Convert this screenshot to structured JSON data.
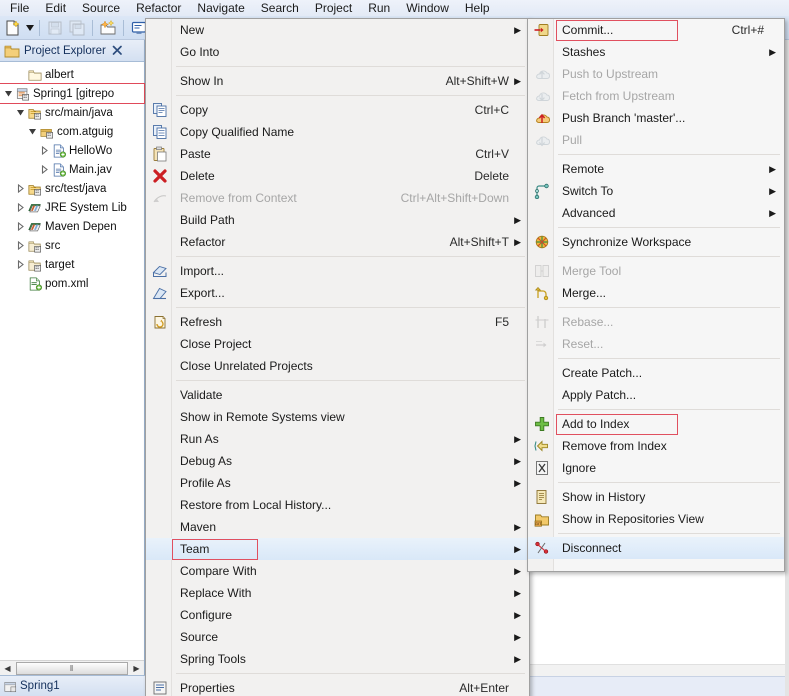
{
  "menubar": {
    "items": [
      "File",
      "Edit",
      "Source",
      "Refactor",
      "Navigate",
      "Search",
      "Project",
      "Run",
      "Window",
      "Help"
    ]
  },
  "toolbar": {
    "buttons": [
      {
        "name": "new-wizard-icon",
        "tooltip": "New"
      },
      {
        "name": "new-dropdown-caret-icon",
        "tooltip": "New dropdown"
      },
      {
        "name": "save-icon",
        "tooltip": "Save"
      },
      {
        "name": "save-all-icon",
        "tooltip": "Save All"
      },
      {
        "name": "new-java-package-icon",
        "tooltip": "New Java Package"
      },
      {
        "name": "open-console-icon",
        "tooltip": "Open Console"
      }
    ]
  },
  "explorer": {
    "view_title": "Project Explorer",
    "view_icon": "project-explorer-icon",
    "close_icon": "close-view-icon",
    "bottom_tab_label": "Spring1",
    "scroll_thumb_glyph": "‖",
    "tree": [
      {
        "label": "albert",
        "icon": "folder-icon",
        "indent": 1,
        "arrow": "none",
        "selected": false
      },
      {
        "label": "Spring1  [gitrepo",
        "icon": "java-project-icon",
        "indent": 0,
        "arrow": "expanded",
        "selected": true
      },
      {
        "label": "src/main/java",
        "icon": "source-folder-icon",
        "indent": 1,
        "arrow": "expanded",
        "selected": false
      },
      {
        "label": "com.atguig",
        "icon": "package-icon",
        "indent": 2,
        "arrow": "expanded",
        "selected": false
      },
      {
        "label": "HelloWo",
        "icon": "java-file-icon",
        "indent": 3,
        "arrow": "collapsed",
        "selected": false
      },
      {
        "label": "Main.jav",
        "icon": "java-file-icon",
        "indent": 3,
        "arrow": "collapsed",
        "selected": false
      },
      {
        "label": "src/test/java",
        "icon": "source-folder-icon",
        "indent": 1,
        "arrow": "collapsed",
        "selected": false
      },
      {
        "label": "JRE System Lib",
        "icon": "library-icon",
        "indent": 1,
        "arrow": "collapsed",
        "selected": false
      },
      {
        "label": "Maven Depen",
        "icon": "library-icon",
        "indent": 1,
        "arrow": "collapsed",
        "selected": false
      },
      {
        "label": "src",
        "icon": "folder-git-icon",
        "indent": 1,
        "arrow": "collapsed",
        "selected": false
      },
      {
        "label": "target",
        "icon": "folder-git-icon",
        "indent": 1,
        "arrow": "collapsed",
        "selected": false
      },
      {
        "label": "pom.xml",
        "icon": "xml-file-icon",
        "indent": 1,
        "arrow": "none",
        "selected": false
      }
    ]
  },
  "context_menu": {
    "items": [
      {
        "label": "New",
        "accel": "",
        "arrow": true,
        "icon": "",
        "disabled": false,
        "separator_after": false
      },
      {
        "label": "Go Into",
        "accel": "",
        "arrow": false,
        "icon": "",
        "disabled": false,
        "separator_after": true
      },
      {
        "label": "Show In",
        "accel": "Alt+Shift+W",
        "arrow": true,
        "icon": "",
        "disabled": false,
        "separator_after": true
      },
      {
        "label": "Copy",
        "accel": "Ctrl+C",
        "arrow": false,
        "icon": "copy-icon",
        "disabled": false,
        "separator_after": false
      },
      {
        "label": "Copy Qualified Name",
        "accel": "",
        "arrow": false,
        "icon": "copy-qualified-icon",
        "disabled": false,
        "separator_after": false
      },
      {
        "label": "Paste",
        "accel": "Ctrl+V",
        "arrow": false,
        "icon": "paste-icon",
        "disabled": false,
        "separator_after": false
      },
      {
        "label": "Delete",
        "accel": "Delete",
        "arrow": false,
        "icon": "delete-icon",
        "disabled": false,
        "separator_after": false
      },
      {
        "label": "Remove from Context",
        "accel": "Ctrl+Alt+Shift+Down",
        "arrow": false,
        "icon": "remove-context-icon",
        "disabled": true,
        "separator_after": false
      },
      {
        "label": "Build Path",
        "accel": "",
        "arrow": true,
        "icon": "",
        "disabled": false,
        "separator_after": false
      },
      {
        "label": "Refactor",
        "accel": "Alt+Shift+T",
        "arrow": true,
        "icon": "",
        "disabled": false,
        "separator_after": true
      },
      {
        "label": "Import...",
        "accel": "",
        "arrow": false,
        "icon": "import-icon",
        "disabled": false,
        "separator_after": false
      },
      {
        "label": "Export...",
        "accel": "",
        "arrow": false,
        "icon": "export-icon",
        "disabled": false,
        "separator_after": true
      },
      {
        "label": "Refresh",
        "accel": "F5",
        "arrow": false,
        "icon": "refresh-icon",
        "disabled": false,
        "separator_after": false
      },
      {
        "label": "Close Project",
        "accel": "",
        "arrow": false,
        "icon": "",
        "disabled": false,
        "separator_after": false
      },
      {
        "label": "Close Unrelated Projects",
        "accel": "",
        "arrow": false,
        "icon": "",
        "disabled": false,
        "separator_after": true
      },
      {
        "label": "Validate",
        "accel": "",
        "arrow": false,
        "icon": "",
        "disabled": false,
        "separator_after": false
      },
      {
        "label": "Show in Remote Systems view",
        "accel": "",
        "arrow": false,
        "icon": "",
        "disabled": false,
        "separator_after": false
      },
      {
        "label": "Run As",
        "accel": "",
        "arrow": true,
        "icon": "",
        "disabled": false,
        "separator_after": false
      },
      {
        "label": "Debug As",
        "accel": "",
        "arrow": true,
        "icon": "",
        "disabled": false,
        "separator_after": false
      },
      {
        "label": "Profile As",
        "accel": "",
        "arrow": true,
        "icon": "",
        "disabled": false,
        "separator_after": false
      },
      {
        "label": "Restore from Local History...",
        "accel": "",
        "arrow": false,
        "icon": "",
        "disabled": false,
        "separator_after": false
      },
      {
        "label": "Maven",
        "accel": "",
        "arrow": true,
        "icon": "",
        "disabled": false,
        "separator_after": false
      },
      {
        "label": "Team",
        "accel": "",
        "arrow": true,
        "icon": "",
        "disabled": false,
        "separator_after": false,
        "highlighted": true,
        "boxed": true
      },
      {
        "label": "Compare With",
        "accel": "",
        "arrow": true,
        "icon": "",
        "disabled": false,
        "separator_after": false
      },
      {
        "label": "Replace With",
        "accel": "",
        "arrow": true,
        "icon": "",
        "disabled": false,
        "separator_after": false
      },
      {
        "label": "Configure",
        "accel": "",
        "arrow": true,
        "icon": "",
        "disabled": false,
        "separator_after": false
      },
      {
        "label": "Source",
        "accel": "",
        "arrow": true,
        "icon": "",
        "disabled": false,
        "separator_after": false
      },
      {
        "label": "Spring Tools",
        "accel": "",
        "arrow": true,
        "icon": "",
        "disabled": false,
        "separator_after": true
      },
      {
        "label": "Properties",
        "accel": "Alt+Enter",
        "arrow": false,
        "icon": "properties-icon",
        "disabled": false,
        "separator_after": false
      }
    ]
  },
  "team_submenu": {
    "items": [
      {
        "label": "Commit...",
        "accel": "Ctrl+#",
        "arrow": false,
        "icon": "git-commit-icon",
        "disabled": false,
        "separator_after": false,
        "boxed": true
      },
      {
        "label": "Stashes",
        "accel": "",
        "arrow": true,
        "icon": "",
        "disabled": false,
        "separator_after": false
      },
      {
        "label": "Push to Upstream",
        "accel": "",
        "arrow": false,
        "icon": "push-upstream-icon",
        "disabled": true,
        "separator_after": false
      },
      {
        "label": "Fetch from Upstream",
        "accel": "",
        "arrow": false,
        "icon": "fetch-upstream-icon",
        "disabled": true,
        "separator_after": false
      },
      {
        "label": "Push Branch 'master'...",
        "accel": "",
        "arrow": false,
        "icon": "push-branch-icon",
        "disabled": false,
        "separator_after": false
      },
      {
        "label": "Pull",
        "accel": "",
        "arrow": false,
        "icon": "pull-icon",
        "disabled": true,
        "separator_after": true
      },
      {
        "label": "Remote",
        "accel": "",
        "arrow": true,
        "icon": "",
        "disabled": false,
        "separator_after": false
      },
      {
        "label": "Switch To",
        "accel": "",
        "arrow": true,
        "icon": "switch-to-icon",
        "disabled": false,
        "separator_after": false
      },
      {
        "label": "Advanced",
        "accel": "",
        "arrow": true,
        "icon": "",
        "disabled": false,
        "separator_after": true
      },
      {
        "label": "Synchronize Workspace",
        "accel": "",
        "arrow": false,
        "icon": "synchronize-icon",
        "disabled": false,
        "separator_after": true
      },
      {
        "label": "Merge Tool",
        "accel": "",
        "arrow": false,
        "icon": "merge-tool-icon",
        "disabled": true,
        "separator_after": false
      },
      {
        "label": "Merge...",
        "accel": "",
        "arrow": false,
        "icon": "merge-icon",
        "disabled": false,
        "separator_after": true
      },
      {
        "label": "Rebase...",
        "accel": "",
        "arrow": false,
        "icon": "rebase-icon",
        "disabled": true,
        "separator_after": false
      },
      {
        "label": "Reset...",
        "accel": "",
        "arrow": false,
        "icon": "reset-icon",
        "disabled": true,
        "separator_after": true
      },
      {
        "label": "Create Patch...",
        "accel": "",
        "arrow": false,
        "icon": "",
        "disabled": false,
        "separator_after": false
      },
      {
        "label": "Apply Patch...",
        "accel": "",
        "arrow": false,
        "icon": "",
        "disabled": false,
        "separator_after": true
      },
      {
        "label": "Add to Index",
        "accel": "",
        "arrow": false,
        "icon": "add-to-index-icon",
        "disabled": false,
        "separator_after": false,
        "boxed": true
      },
      {
        "label": "Remove from Index",
        "accel": "",
        "arrow": false,
        "icon": "remove-index-icon",
        "disabled": false,
        "separator_after": false
      },
      {
        "label": "Ignore",
        "accel": "",
        "arrow": false,
        "icon": "ignore-icon",
        "disabled": false,
        "separator_after": true
      },
      {
        "label": "Show in History",
        "accel": "",
        "arrow": false,
        "icon": "history-icon",
        "disabled": false,
        "separator_after": false
      },
      {
        "label": "Show in Repositories View",
        "accel": "",
        "arrow": false,
        "icon": "repositories-icon",
        "disabled": false,
        "separator_after": true
      },
      {
        "label": "Disconnect",
        "accel": "",
        "arrow": false,
        "icon": "disconnect-icon",
        "disabled": false,
        "separator_after": false,
        "highlighted": true
      }
    ]
  },
  "colors": {
    "highlight_box": "#e0505f",
    "menu_bg": "#f2f1f0",
    "submenu_bg": "#f6f6f6",
    "selection": "#d9e8f8",
    "toolbar_bg": "#cfdef2",
    "tree_link": "#14305c"
  }
}
